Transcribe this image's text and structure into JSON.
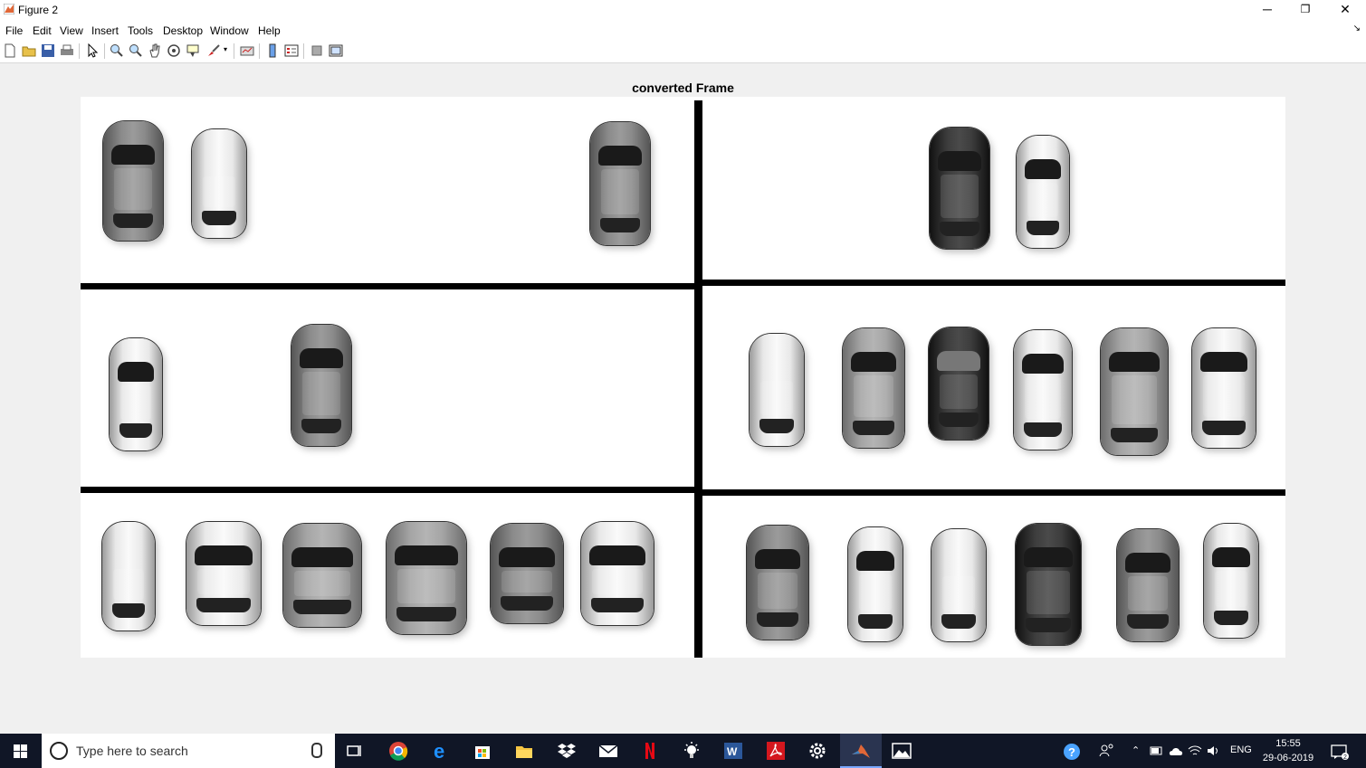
{
  "window": {
    "title": "Figure 2",
    "controls": [
      "─",
      "❐",
      "✕"
    ]
  },
  "menu": [
    "File",
    "Edit",
    "View",
    "Insert",
    "Tools",
    "Desktop",
    "Window",
    "Help"
  ],
  "toolbar": {
    "icons": [
      "new-figure-icon",
      "open-file-icon",
      "save-icon",
      "print-icon",
      "edit-plot-icon",
      "zoom-in-icon",
      "zoom-out-icon",
      "pan-icon",
      "rotate-3d-icon",
      "data-cursor-icon",
      "brush-icon",
      "link-plot-icon",
      "colorbar-icon",
      "legend-icon",
      "hide-plot-tools-icon",
      "show-plot-tools-icon"
    ]
  },
  "figure": {
    "title": "converted Frame"
  },
  "taskbar": {
    "search_placeholder": "Type here to search",
    "apps": [
      "task-view-icon",
      "chrome-icon",
      "edge-icon",
      "store-icon",
      "file-explorer-icon",
      "dropbox-icon",
      "mail-icon",
      "netflix-icon",
      "bulb-icon",
      "word-icon",
      "acrobat-icon",
      "settings-icon",
      "matlab-icon",
      "photos-icon"
    ],
    "tray": {
      "language": "ENG"
    },
    "time": "15:55",
    "date": "29-06-2019"
  },
  "colors": {
    "taskbar_bg": "#101626",
    "window_bg": "#f0f0f0",
    "matlab_accent": "#e16737"
  }
}
